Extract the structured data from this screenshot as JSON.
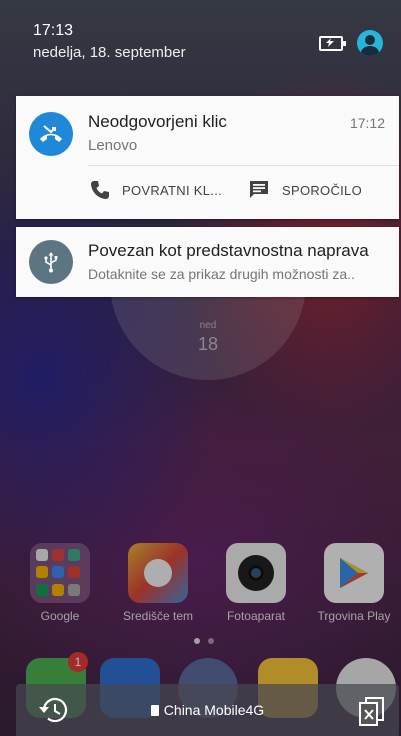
{
  "status": {
    "time": "17:13",
    "date": "nedelja, 18. september"
  },
  "notifications": [
    {
      "title": "Neodgovorjeni klic",
      "subtitle": "Lenovo",
      "time": "17:12",
      "icon": "missed-call-icon",
      "icon_color": "#1f88d8",
      "actions": [
        {
          "label": "POVRATNI KL...",
          "icon": "phone-icon"
        },
        {
          "label": "SPOROČILO",
          "icon": "message-icon"
        }
      ]
    },
    {
      "title": "Povezan kot predstavnostna naprava",
      "subtitle": "Dotaknite se za prikaz drugih možnosti za..",
      "icon": "usb-icon",
      "icon_color": "#5d7583"
    }
  ],
  "clock_widget": {
    "day": "ned",
    "date": "18"
  },
  "apps": [
    {
      "label": "Google",
      "icon": "google-folder-icon"
    },
    {
      "label": "Središče tem",
      "icon": "theme-center-icon"
    },
    {
      "label": "Fotoaparat",
      "icon": "camera-icon"
    },
    {
      "label": "Trgovina Play",
      "icon": "play-store-icon"
    }
  ],
  "dock": {
    "phone_badge": "1"
  },
  "bottom_bar": {
    "carrier": "China Mobile4G"
  }
}
